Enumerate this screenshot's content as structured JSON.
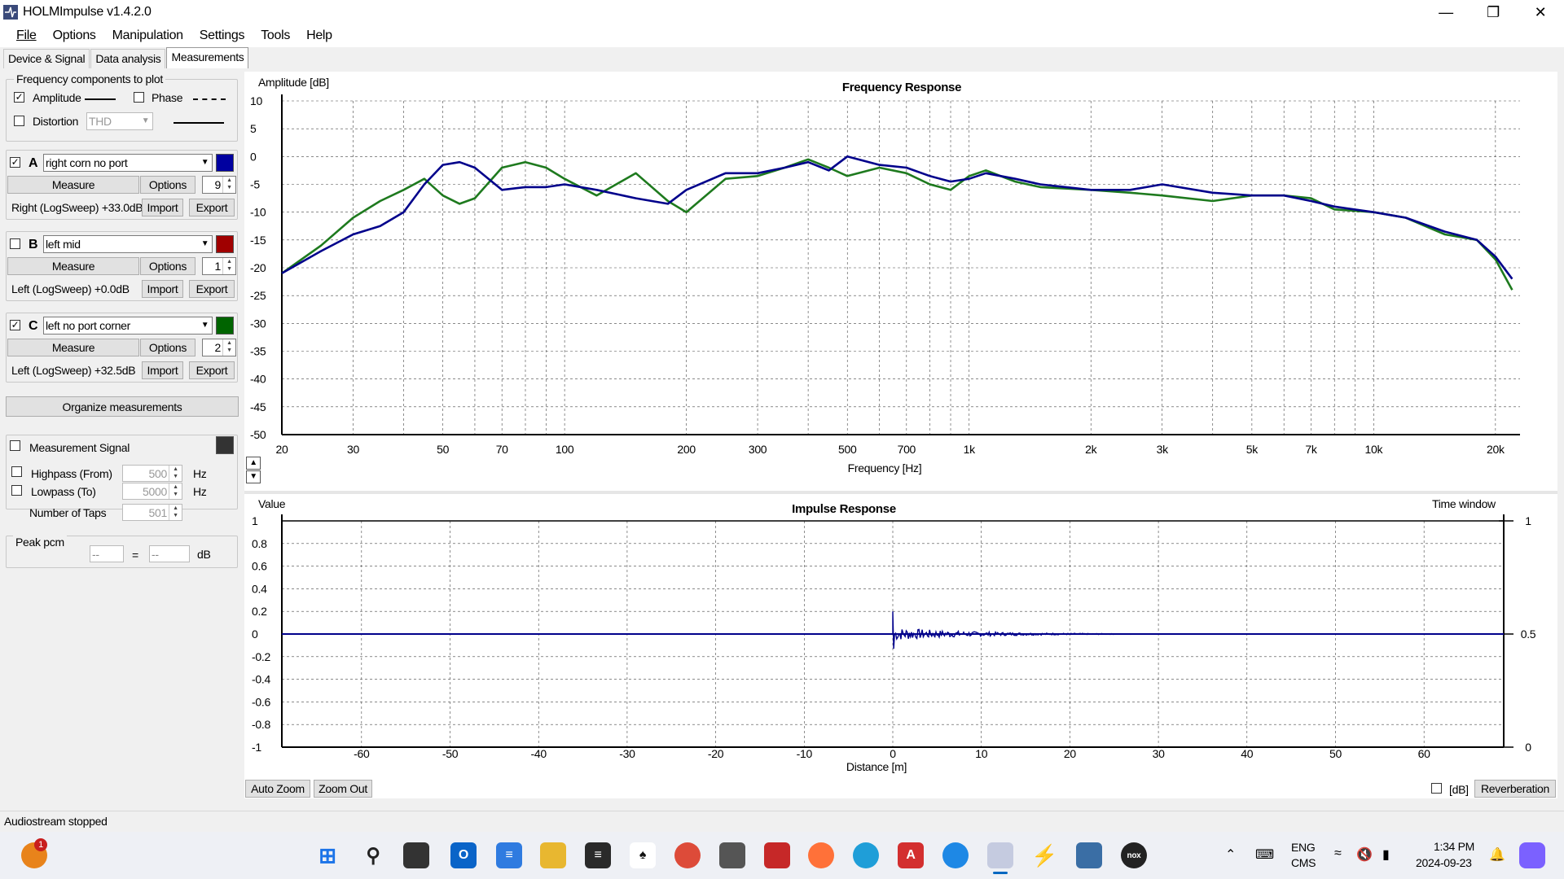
{
  "app": {
    "title": "HOLMImpulse  v1.4.2.0"
  },
  "menu": [
    "File",
    "Options",
    "Manipulation",
    "Settings",
    "Tools",
    "Help"
  ],
  "tabs": [
    "Device & Signal",
    "Data analysis",
    "Measurements"
  ],
  "freq_group": {
    "title": "Frequency components to plot",
    "amplitude_label": "Amplitude",
    "amplitude_checked": true,
    "phase_label": "Phase",
    "phase_checked": false,
    "distortion_label": "Distortion",
    "distortion_checked": false,
    "distortion_value": "THD"
  },
  "measurements": [
    {
      "letter": "A",
      "checked": true,
      "name": "right corn no port",
      "color": "#0000a0",
      "measure": "Measure",
      "options": "Options",
      "count": "9",
      "info": "Right (LogSweep) +33.0dB",
      "import": "Import",
      "export": "Export"
    },
    {
      "letter": "B",
      "checked": false,
      "name": "left mid",
      "color": "#a00000",
      "measure": "Measure",
      "options": "Options",
      "count": "1",
      "info": "Left (LogSweep) +0.0dB",
      "import": "Import",
      "export": "Export"
    },
    {
      "letter": "C",
      "checked": true,
      "name": "left no port corner",
      "color": "#006400",
      "measure": "Measure",
      "options": "Options",
      "count": "2",
      "info": "Left (LogSweep) +32.5dB",
      "import": "Import",
      "export": "Export"
    }
  ],
  "organize_label": "Organize measurements",
  "signal": {
    "label": "Measurement Signal",
    "checked": false,
    "highpass_label": "Highpass (From)",
    "highpass_value": "500",
    "lowpass_label": "Lowpass (To)",
    "lowpass_value": "5000",
    "hz": "Hz",
    "taps_label": "Number of Taps",
    "taps_value": "501"
  },
  "peak": {
    "title": "Peak pcm",
    "value1": "--",
    "eq": "=",
    "value2": "--",
    "unit": "dB"
  },
  "freq_chart_title": "Frequency Response",
  "impulse_chart_title": "Impulse Response",
  "bottom_buttons": {
    "auto_zoom": "Auto Zoom",
    "zoom_out": "Zoom Out",
    "db_label": "[dB]",
    "reverberation": "Reverberation"
  },
  "status": "Audiostream stopped",
  "taskbar": {
    "lang1": "ENG",
    "lang2": "CMS",
    "time": "1:34 PM",
    "date": "2024-09-23",
    "badge": "1"
  },
  "chart_data": [
    {
      "type": "line",
      "title": "Frequency Response",
      "xlabel": "Frequency [Hz]",
      "ylabel": "Amplitude [dB]",
      "xscale": "log",
      "xlim": [
        20,
        23000
      ],
      "ylim": [
        -50,
        10
      ],
      "x_ticks": [
        20,
        30,
        50,
        70,
        100,
        200,
        300,
        500,
        700,
        1000,
        2000,
        3000,
        5000,
        7000,
        10000,
        20000
      ],
      "x_tick_labels": [
        "20",
        "30",
        "50",
        "70",
        "100",
        "200",
        "300",
        "500",
        "700",
        "1k",
        "2k",
        "3k",
        "5k",
        "7k",
        "10k",
        "20k"
      ],
      "y_ticks": [
        10,
        5,
        0,
        -5,
        -10,
        -15,
        -20,
        -25,
        -30,
        -35,
        -40,
        -45,
        -50
      ],
      "grid": true,
      "series": [
        {
          "color": "#00008b",
          "x": [
            20,
            25,
            30,
            35,
            40,
            45,
            50,
            55,
            60,
            70,
            80,
            90,
            100,
            120,
            150,
            180,
            200,
            250,
            300,
            350,
            400,
            450,
            500,
            600,
            700,
            800,
            900,
            1000,
            1100,
            1300,
            1500,
            2000,
            2500,
            3000,
            4000,
            5000,
            6000,
            7000,
            8000,
            10000,
            12000,
            15000,
            18000,
            20000,
            22000
          ],
          "y": [
            -21,
            -17,
            -14,
            -12.5,
            -10,
            -5,
            -1.5,
            -1,
            -2,
            -6,
            -5.5,
            -5.5,
            -5,
            -6,
            -7.5,
            -8.5,
            -6,
            -3,
            -3,
            -2,
            -1,
            -2.5,
            0,
            -1.5,
            -2,
            -3.5,
            -4.5,
            -4,
            -3,
            -4,
            -5,
            -6,
            -6,
            -5,
            -6.5,
            -7,
            -7,
            -8,
            -9,
            -10,
            -11,
            -13.5,
            -15,
            -18,
            -22
          ]
        },
        {
          "color": "#1e7a1e",
          "x": [
            20,
            25,
            30,
            35,
            40,
            45,
            50,
            55,
            60,
            70,
            80,
            90,
            100,
            120,
            150,
            180,
            200,
            250,
            300,
            350,
            400,
            450,
            500,
            600,
            700,
            800,
            900,
            1000,
            1100,
            1300,
            1500,
            2000,
            2500,
            3000,
            4000,
            5000,
            6000,
            7000,
            8000,
            10000,
            12000,
            15000,
            18000,
            20000,
            22000
          ],
          "y": [
            -21,
            -16,
            -11,
            -8,
            -6,
            -4,
            -7,
            -8.5,
            -7.5,
            -2,
            -1,
            -2,
            -4,
            -7,
            -3,
            -8,
            -10,
            -4,
            -3.5,
            -2,
            -0.5,
            -2,
            -3.5,
            -2,
            -3,
            -5,
            -6,
            -3.5,
            -2.5,
            -4.5,
            -5.5,
            -6,
            -6.5,
            -7,
            -8,
            -7,
            -7,
            -7.5,
            -9.5,
            -10,
            -11,
            -14,
            -15,
            -18.5,
            -24
          ]
        }
      ]
    },
    {
      "type": "line",
      "title": "Impulse Response",
      "xlabel": "Distance [m]",
      "ylabel": "Value",
      "y2label": "Time window",
      "xlim": [
        -69,
        69
      ],
      "ylim": [
        -1,
        1
      ],
      "x_ticks": [
        -60,
        -50,
        -40,
        -30,
        -20,
        -10,
        0,
        10,
        20,
        30,
        40,
        50,
        60
      ],
      "y_ticks": [
        1,
        0.8,
        0.6,
        0.4,
        0.2,
        0,
        -0.2,
        -0.4,
        -0.6,
        -0.8,
        -1
      ],
      "y2_ticks": [
        1,
        0.5,
        0
      ],
      "grid": true,
      "series": [
        {
          "color": "#00008b",
          "impulse_at": 0,
          "peak": 0.2,
          "trough": -0.13,
          "decay_end": 27
        }
      ]
    }
  ]
}
